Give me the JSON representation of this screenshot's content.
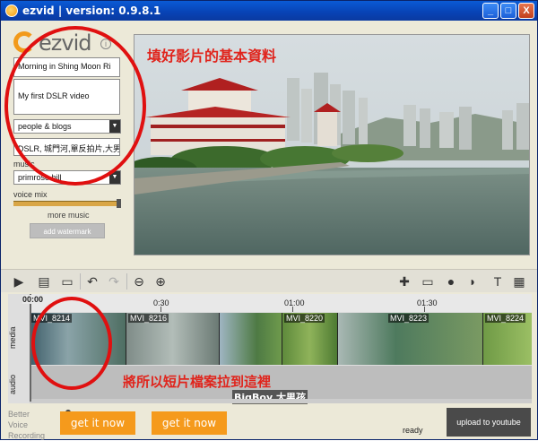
{
  "window": {
    "title": "ezvid | version: 0.9.8.1",
    "minimize": "_",
    "maximize": "□",
    "close": "X"
  },
  "logo": {
    "text": "ezvid",
    "info": "i"
  },
  "form": {
    "title_value": "Morning in Shing Moon Ri",
    "description_value": "My first DSLR video",
    "category_value": "people & blogs",
    "tags_value": "DSLR, 城門河,單反拍片,大男",
    "music_label": "music",
    "music_value": "primrose hill",
    "voice_mix_label": "voice mix",
    "voice_mix_level": 1.0,
    "more_music": "more music",
    "add_watermark": "add watermark"
  },
  "preview": {
    "annotation": "填好影片的基本資料"
  },
  "timeline": {
    "playhead": "00:00",
    "ticks": [
      "0:30",
      "01:00",
      "01:30"
    ],
    "track_labels": {
      "media": "media",
      "audio": "audio"
    },
    "clips": [
      {
        "name": "MVI_8214",
        "color": "#5a7a8a"
      },
      {
        "name": "MVI_8216",
        "color": "#7a8a86"
      },
      {
        "name": "MVI_8220",
        "color": "#6a8a48"
      },
      {
        "name": "MVI_8223",
        "color": "#5e7e6a"
      },
      {
        "name": "MVI_8224",
        "color": "#6a8e42"
      }
    ],
    "audio_annotation": "將所以短片檔案拉到這裡",
    "credit": "BigBoy 大男孩"
  },
  "bottom": {
    "promo": [
      "Better",
      "Voice",
      "Recording"
    ],
    "get_it_now_1": "get it now",
    "get_it_now_2": "get it now",
    "status": "ready",
    "upload": "upload to youtube"
  },
  "toolbar_icons": [
    "play-icon",
    "add-media-icon",
    "open-folder-icon",
    "undo-icon",
    "redo-icon",
    "zoom-out-icon",
    "zoom-in-icon",
    "game-capture-icon",
    "screen-capture-icon",
    "microphone-icon",
    "speech-icon",
    "text-icon",
    "film-icon"
  ],
  "colors": {
    "accent": "#f59a1c",
    "annotation": "#e01010",
    "titlebar": "#0842b4"
  }
}
